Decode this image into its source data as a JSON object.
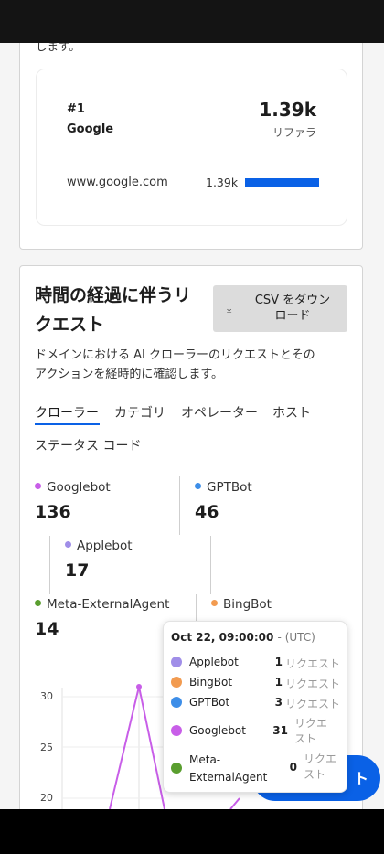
{
  "card1": {
    "description_tail": "します。",
    "rank": "#1",
    "site": "Google",
    "value": "1.39k",
    "unit": "リファラ",
    "domain": "www.google.com",
    "domain_value": "1.39k"
  },
  "card2": {
    "title_line1": "時間の経過に伴うリ",
    "title_line2": "クエスト",
    "csv_line1": "CSV をダウン",
    "csv_line2": "ロード",
    "description_line1": "ドメインにおける AI クローラーのリクエストとその",
    "description_line2": "アクションを経時的に確認します。",
    "tabs": [
      "クローラー",
      "カテゴリ",
      "オペレーター",
      "ホスト",
      "ステータス コード"
    ],
    "metrics": [
      {
        "label": "Googlebot",
        "value": "136",
        "color": "#c85ee8"
      },
      {
        "label": "GPTBot",
        "value": "46",
        "color": "#3d8ee8"
      },
      {
        "label": "Applebot",
        "value": "17",
        "color": "#a08ee8"
      },
      {
        "label": "Meta-ExternalAgent",
        "value": "14",
        "color": "#5a9e2f"
      },
      {
        "label": "BingBot",
        "value": "",
        "color": "#f29b50"
      }
    ]
  },
  "chart": {
    "y_ticks": [
      "30",
      "25",
      "20"
    ]
  },
  "tooltip": {
    "date": "Oct 22, 09:00:00",
    "timezone": "- (UTC)",
    "rows": [
      {
        "name": "Applebot",
        "count": "1",
        "unit": "リクエスト",
        "color": "#a08ee8"
      },
      {
        "name": "BingBot",
        "count": "1",
        "unit": "リクエスト",
        "color": "#f29b50"
      },
      {
        "name": "GPTBot",
        "count": "3",
        "unit": "リクエスト",
        "color": "#3d8ee8"
      },
      {
        "name": "Googlebot",
        "count": "31",
        "unit_line1": "リクエ",
        "unit_line2": "スト",
        "color": "#c85ee8"
      },
      {
        "name_line1": "Meta-",
        "name_line2": "ExternalAgent",
        "count": "0",
        "unit_line1": "リクエ",
        "unit_line2": "スト",
        "color": "#5a9e2f"
      }
    ]
  },
  "fab": {
    "label": "ト"
  }
}
